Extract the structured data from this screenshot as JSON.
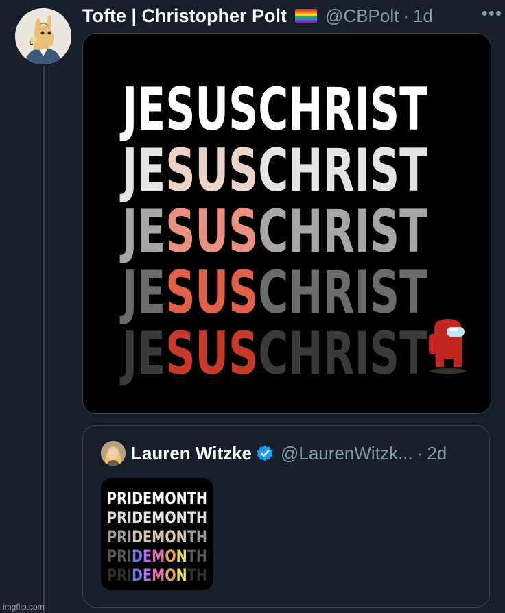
{
  "tweet": {
    "display_name": "Tofte | Christopher Polt",
    "handle": "@CBPolt",
    "separator": "·",
    "time": "1d",
    "more_label": "•••",
    "image": {
      "rows": [
        {
          "prefix": "JE",
          "highlight": "SUS",
          "suffix": "CHRIST",
          "base_color": "#ffffff",
          "highlight_color": "#ffffff"
        },
        {
          "prefix": "JE",
          "highlight": "SUS",
          "suffix": "CHRIST",
          "base_color": "#e4e4e4",
          "highlight_color": "#ecd3c8"
        },
        {
          "prefix": "JE",
          "highlight": "SUS",
          "suffix": "CHRIST",
          "base_color": "#a6a6a6",
          "highlight_color": "#e99180"
        },
        {
          "prefix": "JE",
          "highlight": "SUS",
          "suffix": "CHRIST",
          "base_color": "#6b6b6b",
          "highlight_color": "#e0604a"
        },
        {
          "prefix": "JE",
          "highlight": "SUS",
          "suffix": "CHRIST",
          "base_color": "#3a3a3a",
          "highlight_color": "#c73a2a"
        }
      ],
      "crewmate_color": "#c0281f"
    }
  },
  "quoted": {
    "display_name": "Lauren Witzke",
    "handle": "@LaurenWitzk...",
    "separator": "·",
    "time": "2d",
    "image": {
      "rows": [
        {
          "prefix": "PRI",
          "highlight": "DEMON",
          "suffix": "TH",
          "base_color": "#ffffff",
          "highlight_color": "#ffffff"
        },
        {
          "prefix": "PRI",
          "highlight": "DEMON",
          "suffix": "TH",
          "base_color": "#dcdcdc",
          "highlight_color": "#e8e8e8"
        },
        {
          "prefix": "PRI",
          "highlight": "DEMON",
          "suffix": "TH",
          "base_color": "#9c9c9c",
          "highlight_color": "#d9c8b0"
        },
        {
          "prefix": "PRI",
          "highlight": "DEMON",
          "suffix": "TH",
          "base_color": "#5a5a5a",
          "highlight_color": "rainbow"
        },
        {
          "prefix": "PRI",
          "highlight": "DEMON",
          "suffix": "TH",
          "base_color": "#303030",
          "highlight_color": "rainbow"
        }
      ],
      "rainbow": [
        "#6a7cf0",
        "#b76ce8",
        "#e86cb0",
        "#e8a85a",
        "#e8e05a"
      ]
    }
  },
  "watermark": "imgflip.com"
}
